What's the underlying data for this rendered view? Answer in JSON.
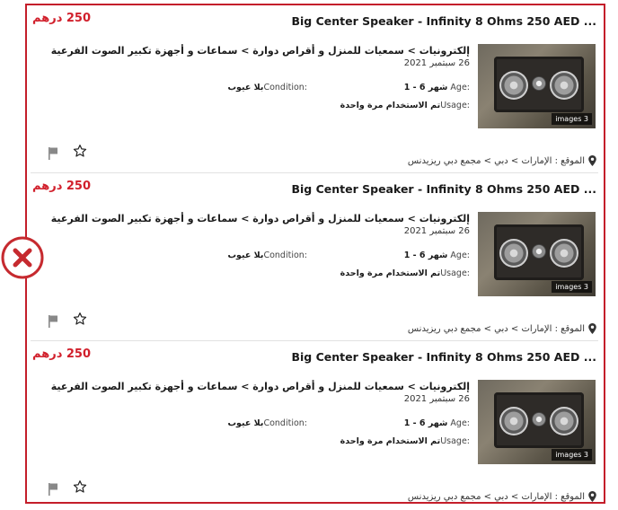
{
  "listings": [
    {
      "price": "250 درهم",
      "title": "Big Center Speaker - Infinity 8 Ohms 250 AED ...",
      "category": "إلكترونيات > سمعيات للمنزل و أقراص دوارة > سماعات و أجهزة تكبير الصوت الفرعية",
      "date": "26 سبتمبر 2021",
      "age_label": "Age: ",
      "age_value": "1 - 6 شهر",
      "condition_label": "Condition: ",
      "condition_value": "بلا عيوب",
      "usage_label": "Usage: ",
      "usage_value": "تم الاستخدام مرة واحدة",
      "location": "الموقع : الإمارات > دبي > مجمع دبي ريزيدنس",
      "image_count": "images 3"
    },
    {
      "price": "250 درهم",
      "title": "Big Center Speaker - Infinity 8 Ohms 250 AED ...",
      "category": "إلكترونيات > سمعيات للمنزل و أقراص دوارة > سماعات و أجهزة تكبير الصوت الفرعية",
      "date": "26 سبتمبر 2021",
      "age_label": "Age: ",
      "age_value": "1 - 6 شهر",
      "condition_label": "Condition: ",
      "condition_value": "بلا عيوب",
      "usage_label": "Usage: ",
      "usage_value": "تم الاستخدام مرة واحدة",
      "location": "الموقع : الإمارات > دبي > مجمع دبي ريزيدنس",
      "image_count": "images 3"
    },
    {
      "price": "250 درهم",
      "title": "Big Center Speaker - Infinity 8 Ohms 250 AED ...",
      "category": "إلكترونيات > سمعيات للمنزل و أقراص دوارة > سماعات و أجهزة تكبير الصوت الفرعية",
      "date": "26 سبتمبر 2021",
      "age_label": "Age: ",
      "age_value": "1 - 6 شهر",
      "condition_label": "Condition: ",
      "condition_value": "بلا عيوب",
      "usage_label": "Usage: ",
      "usage_value": "تم الاستخدام مرة واحدة",
      "location": "الموقع : الإمارات > دبي > مجمع دبي ريزيدنس",
      "image_count": "images 3"
    }
  ],
  "icons": {
    "flag": "flag-icon",
    "star": "star-icon",
    "pin": "location-pin-icon",
    "reject": "reject-x-icon"
  },
  "colors": {
    "frame": "#c41e2a",
    "price": "#d11f2b",
    "reject": "#c62a2f"
  }
}
